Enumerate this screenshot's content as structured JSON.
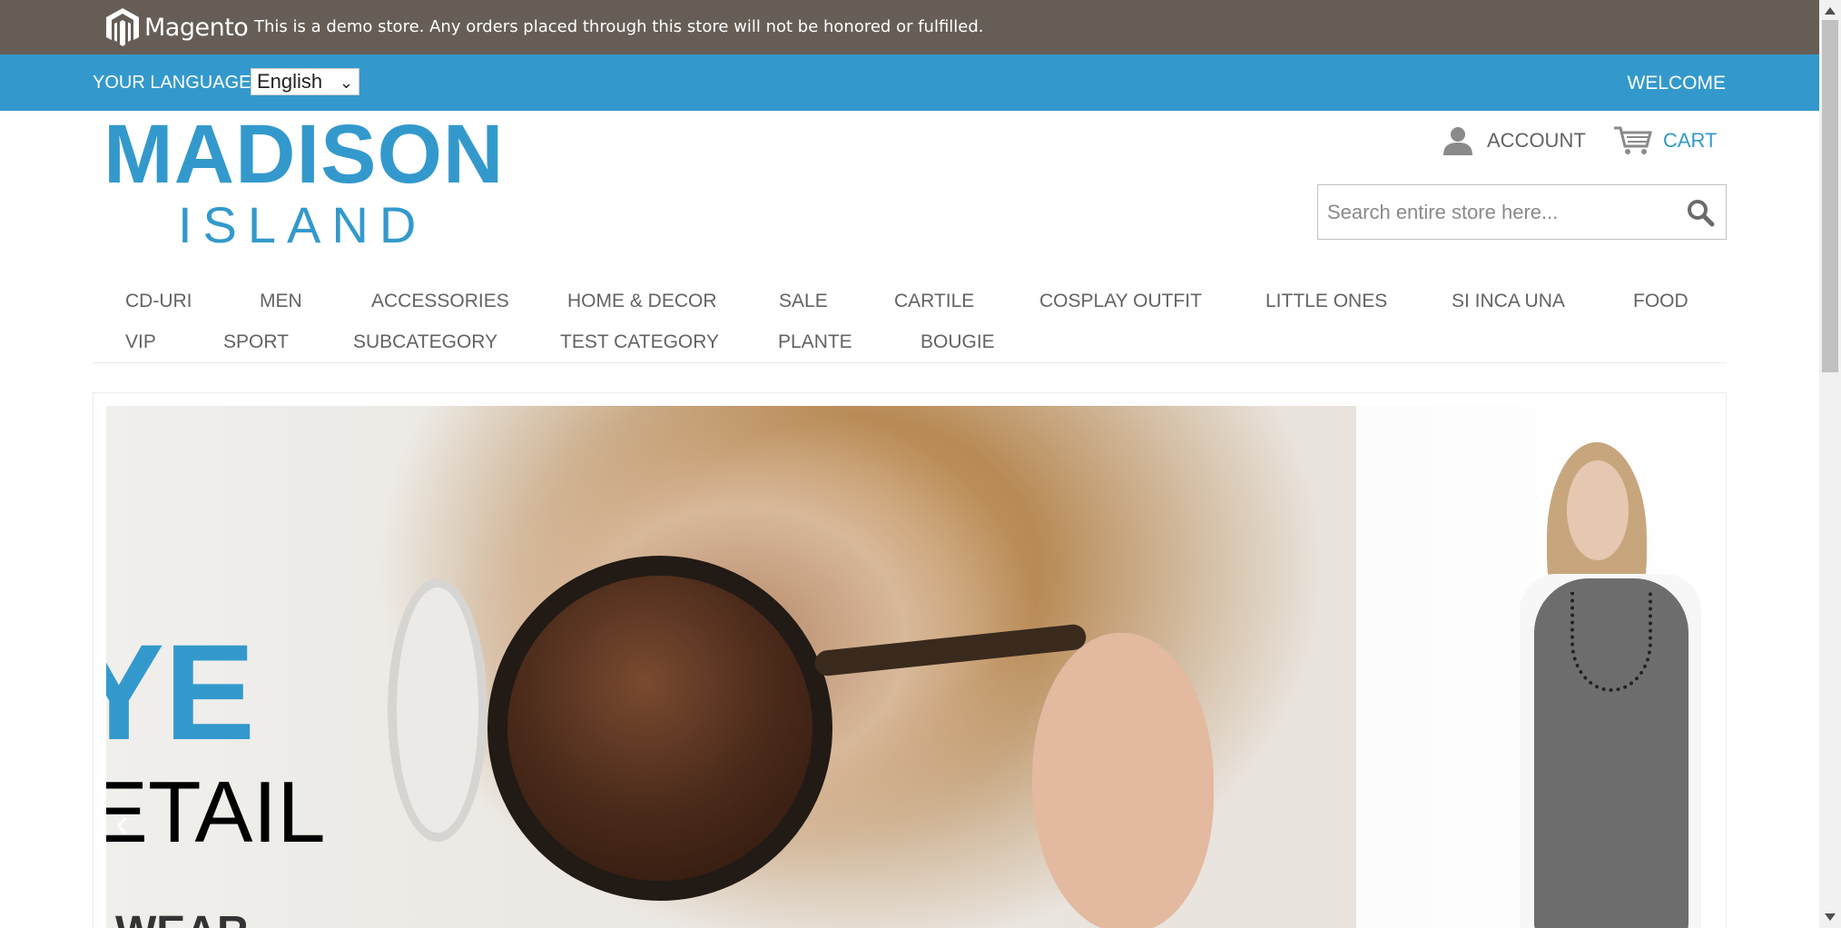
{
  "demo_notice": {
    "logo_text": "Magento",
    "text": "This is a demo store. Any orders placed through this store will not be honored or fulfilled."
  },
  "header_bar": {
    "language_label": "Your Language:",
    "language_selected": "English",
    "welcome": "WELCOME"
  },
  "logo": {
    "line1": "MADISON",
    "line2": "ISLAND"
  },
  "account": {
    "label": "ACCOUNT",
    "icon": "user-icon"
  },
  "cart": {
    "label": "CART",
    "icon": "cart-icon"
  },
  "search": {
    "placeholder": "Search entire store here...",
    "icon": "search-icon"
  },
  "nav": {
    "items": [
      "CD-URI",
      "MEN",
      "ACCESSORIES",
      "HOME & DECOR",
      "SALE",
      "CARTILE",
      "COSPLAY OUTFIT",
      "LITTLE ONES",
      "SI INCA UNA",
      "FOOD",
      "VIP",
      "SPORT",
      "SUBCATEGORY",
      "TEST CATEGORY",
      "PLANTE",
      "BOUGIE"
    ]
  },
  "hero": {
    "headline_fragment": "YE",
    "subline_fragment": "ETAIL",
    "third_fragment": "WEAR",
    "prev_icon": "chevron-left-icon"
  },
  "colors": {
    "brand_blue": "#3399cc",
    "demo_bar": "#665e56",
    "text_gray": "#636363"
  }
}
